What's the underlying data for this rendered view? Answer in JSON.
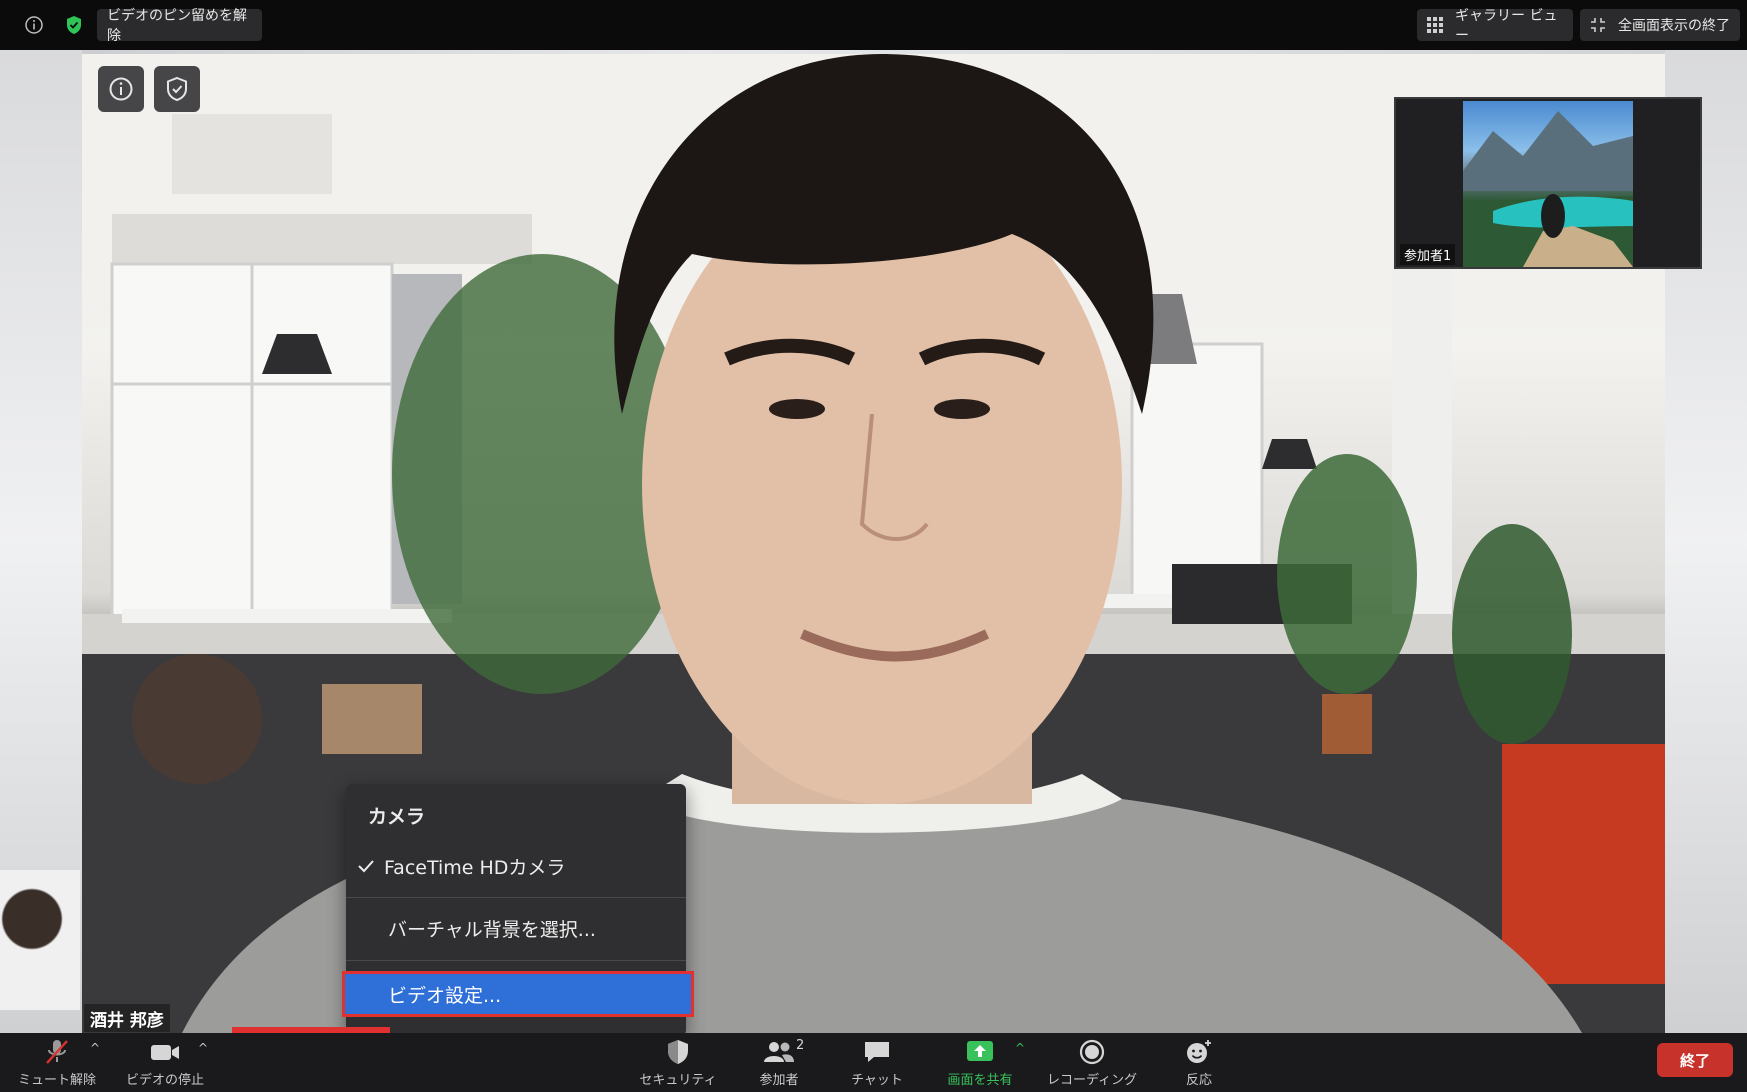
{
  "topbar": {
    "unpin_label": "ビデオのピン留めを解除",
    "gallery_label": "ギャラリー ビュー",
    "exit_fullscreen_label": "全画面表示の終了"
  },
  "thumbnail": {
    "participant_label": "参加者1"
  },
  "main_video": {
    "name_tag": "酒井 邦彦"
  },
  "camera_menu": {
    "header": "カメラ",
    "items": [
      {
        "label": "FaceTime HDカメラ",
        "checked": true
      },
      {
        "label": "バーチャル背景を選択..."
      },
      {
        "label": "ビデオ設定..."
      }
    ]
  },
  "toolbar": {
    "mute_label": "ミュート解除",
    "video_label": "ビデオの停止",
    "security_label": "セキュリティ",
    "participants_label": "参加者",
    "participants_count": "2",
    "chat_label": "チャット",
    "share_label": "画面を共有",
    "record_label": "レコーディング",
    "reactions_label": "反応",
    "end_label": "終了"
  },
  "colors": {
    "share_green": "#39c25b",
    "menu_selected": "#2f6fd8",
    "highlight_red": "#e0302f",
    "end_button": "#c7322a",
    "shield_green": "#2ec456"
  },
  "icons": [
    "info-icon",
    "shield-icon",
    "grid-icon",
    "exit-fullscreen-icon",
    "mic-muted-icon",
    "camera-icon",
    "security-icon",
    "participants-icon",
    "chat-icon",
    "share-icon",
    "record-icon",
    "reactions-icon",
    "checkmark-icon",
    "chevron-up-icon"
  ]
}
